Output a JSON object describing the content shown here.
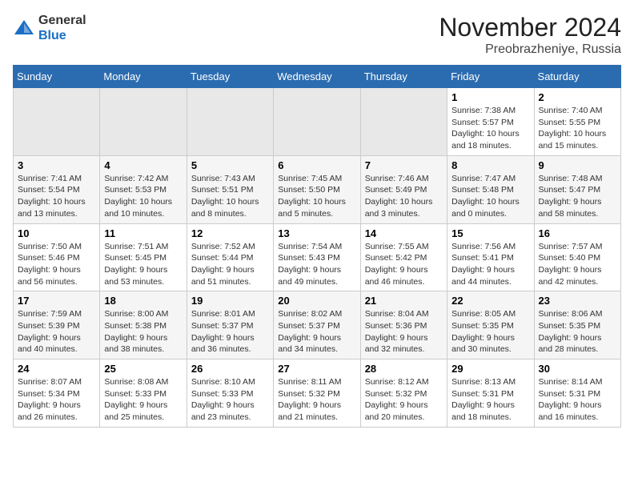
{
  "header": {
    "logo_general": "General",
    "logo_blue": "Blue",
    "month": "November 2024",
    "location": "Preobrazheniye, Russia"
  },
  "weekdays": [
    "Sunday",
    "Monday",
    "Tuesday",
    "Wednesday",
    "Thursday",
    "Friday",
    "Saturday"
  ],
  "weeks": [
    [
      {
        "day": "",
        "info": ""
      },
      {
        "day": "",
        "info": ""
      },
      {
        "day": "",
        "info": ""
      },
      {
        "day": "",
        "info": ""
      },
      {
        "day": "",
        "info": ""
      },
      {
        "day": "1",
        "info": "Sunrise: 7:38 AM\nSunset: 5:57 PM\nDaylight: 10 hours\nand 18 minutes."
      },
      {
        "day": "2",
        "info": "Sunrise: 7:40 AM\nSunset: 5:55 PM\nDaylight: 10 hours\nand 15 minutes."
      }
    ],
    [
      {
        "day": "3",
        "info": "Sunrise: 7:41 AM\nSunset: 5:54 PM\nDaylight: 10 hours\nand 13 minutes."
      },
      {
        "day": "4",
        "info": "Sunrise: 7:42 AM\nSunset: 5:53 PM\nDaylight: 10 hours\nand 10 minutes."
      },
      {
        "day": "5",
        "info": "Sunrise: 7:43 AM\nSunset: 5:51 PM\nDaylight: 10 hours\nand 8 minutes."
      },
      {
        "day": "6",
        "info": "Sunrise: 7:45 AM\nSunset: 5:50 PM\nDaylight: 10 hours\nand 5 minutes."
      },
      {
        "day": "7",
        "info": "Sunrise: 7:46 AM\nSunset: 5:49 PM\nDaylight: 10 hours\nand 3 minutes."
      },
      {
        "day": "8",
        "info": "Sunrise: 7:47 AM\nSunset: 5:48 PM\nDaylight: 10 hours\nand 0 minutes."
      },
      {
        "day": "9",
        "info": "Sunrise: 7:48 AM\nSunset: 5:47 PM\nDaylight: 9 hours\nand 58 minutes."
      }
    ],
    [
      {
        "day": "10",
        "info": "Sunrise: 7:50 AM\nSunset: 5:46 PM\nDaylight: 9 hours\nand 56 minutes."
      },
      {
        "day": "11",
        "info": "Sunrise: 7:51 AM\nSunset: 5:45 PM\nDaylight: 9 hours\nand 53 minutes."
      },
      {
        "day": "12",
        "info": "Sunrise: 7:52 AM\nSunset: 5:44 PM\nDaylight: 9 hours\nand 51 minutes."
      },
      {
        "day": "13",
        "info": "Sunrise: 7:54 AM\nSunset: 5:43 PM\nDaylight: 9 hours\nand 49 minutes."
      },
      {
        "day": "14",
        "info": "Sunrise: 7:55 AM\nSunset: 5:42 PM\nDaylight: 9 hours\nand 46 minutes."
      },
      {
        "day": "15",
        "info": "Sunrise: 7:56 AM\nSunset: 5:41 PM\nDaylight: 9 hours\nand 44 minutes."
      },
      {
        "day": "16",
        "info": "Sunrise: 7:57 AM\nSunset: 5:40 PM\nDaylight: 9 hours\nand 42 minutes."
      }
    ],
    [
      {
        "day": "17",
        "info": "Sunrise: 7:59 AM\nSunset: 5:39 PM\nDaylight: 9 hours\nand 40 minutes."
      },
      {
        "day": "18",
        "info": "Sunrise: 8:00 AM\nSunset: 5:38 PM\nDaylight: 9 hours\nand 38 minutes."
      },
      {
        "day": "19",
        "info": "Sunrise: 8:01 AM\nSunset: 5:37 PM\nDaylight: 9 hours\nand 36 minutes."
      },
      {
        "day": "20",
        "info": "Sunrise: 8:02 AM\nSunset: 5:37 PM\nDaylight: 9 hours\nand 34 minutes."
      },
      {
        "day": "21",
        "info": "Sunrise: 8:04 AM\nSunset: 5:36 PM\nDaylight: 9 hours\nand 32 minutes."
      },
      {
        "day": "22",
        "info": "Sunrise: 8:05 AM\nSunset: 5:35 PM\nDaylight: 9 hours\nand 30 minutes."
      },
      {
        "day": "23",
        "info": "Sunrise: 8:06 AM\nSunset: 5:35 PM\nDaylight: 9 hours\nand 28 minutes."
      }
    ],
    [
      {
        "day": "24",
        "info": "Sunrise: 8:07 AM\nSunset: 5:34 PM\nDaylight: 9 hours\nand 26 minutes."
      },
      {
        "day": "25",
        "info": "Sunrise: 8:08 AM\nSunset: 5:33 PM\nDaylight: 9 hours\nand 25 minutes."
      },
      {
        "day": "26",
        "info": "Sunrise: 8:10 AM\nSunset: 5:33 PM\nDaylight: 9 hours\nand 23 minutes."
      },
      {
        "day": "27",
        "info": "Sunrise: 8:11 AM\nSunset: 5:32 PM\nDaylight: 9 hours\nand 21 minutes."
      },
      {
        "day": "28",
        "info": "Sunrise: 8:12 AM\nSunset: 5:32 PM\nDaylight: 9 hours\nand 20 minutes."
      },
      {
        "day": "29",
        "info": "Sunrise: 8:13 AM\nSunset: 5:31 PM\nDaylight: 9 hours\nand 18 minutes."
      },
      {
        "day": "30",
        "info": "Sunrise: 8:14 AM\nSunset: 5:31 PM\nDaylight: 9 hours\nand 16 minutes."
      }
    ]
  ]
}
